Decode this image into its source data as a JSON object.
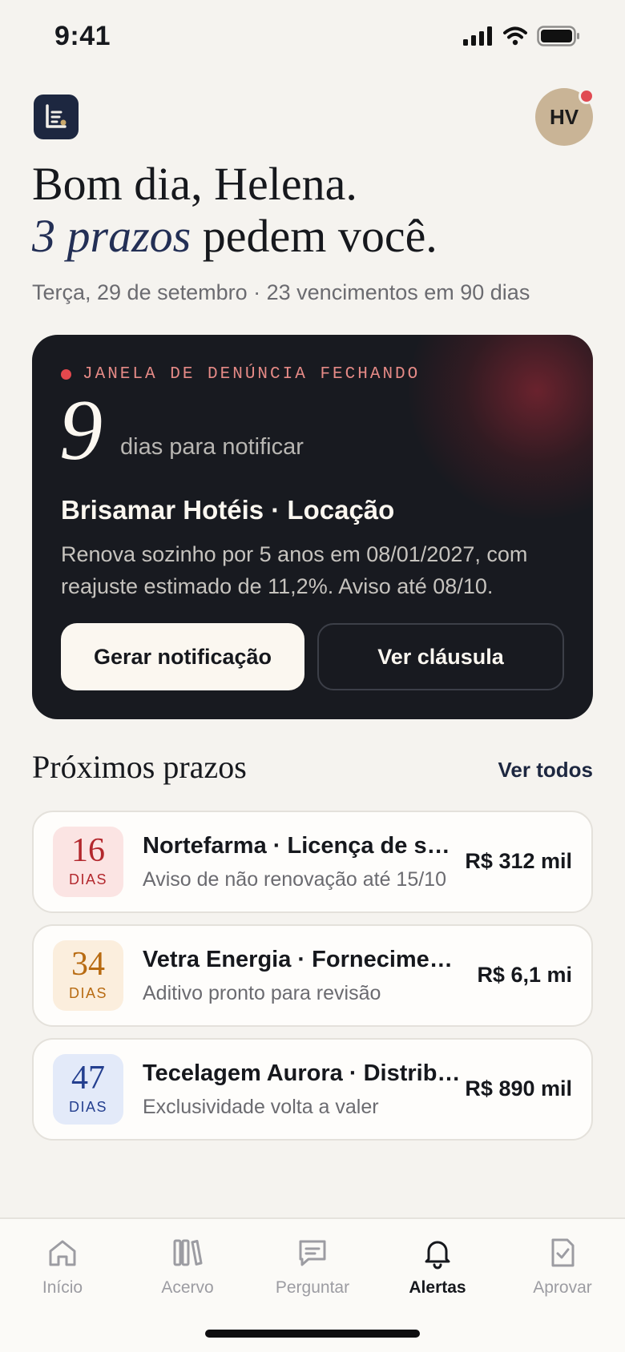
{
  "status_bar": {
    "time": "9:41",
    "icons": [
      "signal-icon",
      "wifi-icon",
      "battery-icon"
    ]
  },
  "header": {
    "logo_icon": "document-list-icon",
    "avatar_initials": "HV",
    "greeting_line1": "Bom dia, Helena.",
    "greeting_accent": "3 prazos",
    "greeting_rest": " pedem você.",
    "subtitle": "Terça, 29 de setembro · 23 vencimentos em 90 dias"
  },
  "hero": {
    "alert_label": "JANELA DE DENÚNCIA FECHANDO",
    "days_number": "9",
    "days_label": "dias para notificar",
    "title": "Brisamar Hotéis · Locação",
    "description": "Renova sozinho por 5 anos em 08/01/2027, com reajuste estimado de 11,2%. Aviso até 08/10.",
    "primary_button": "Gerar notificação",
    "secondary_button": "Ver cláusula"
  },
  "section": {
    "title": "Próximos prazos",
    "link": "Ver todos"
  },
  "deadlines": [
    {
      "days": "16",
      "unit": "DIAS",
      "title": "Nortefarma · Licença de soft...",
      "subtitle": "Aviso de não renovação até 15/10",
      "value": "R$ 312 mil"
    },
    {
      "days": "34",
      "unit": "DIAS",
      "title": "Vetra Energia · Fornecimento",
      "subtitle": "Aditivo pronto para revisão",
      "value": "R$ 6,1 mi"
    },
    {
      "days": "47",
      "unit": "DIAS",
      "title": "Tecelagem Aurora · Distribu...",
      "subtitle": "Exclusividade volta a valer",
      "value": "R$ 890 mil"
    }
  ],
  "tabs": [
    {
      "label": "Início",
      "icon": "home-icon"
    },
    {
      "label": "Acervo",
      "icon": "library-icon"
    },
    {
      "label": "Perguntar",
      "icon": "chat-icon"
    },
    {
      "label": "Alertas",
      "icon": "bell-icon",
      "active": true
    },
    {
      "label": "Aprovar",
      "icon": "approve-icon"
    }
  ],
  "colors": {
    "background": "#f5f3ef",
    "hero_card": "#181a20",
    "accent_navy": "#232f55",
    "alert_red": "#e5484d"
  }
}
